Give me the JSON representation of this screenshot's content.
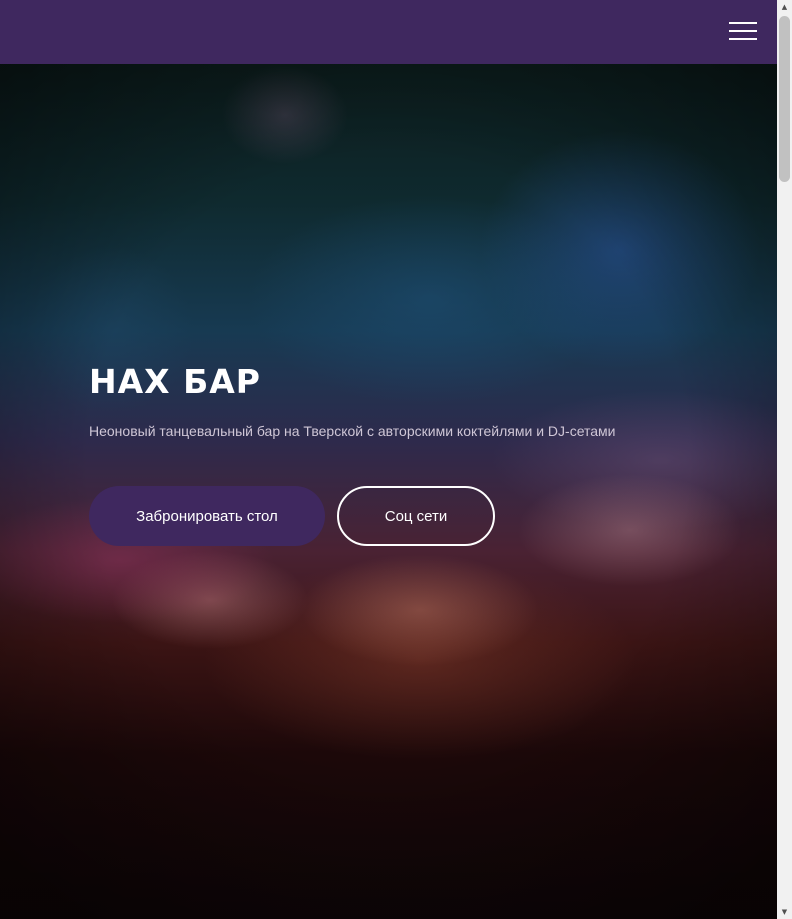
{
  "header": {
    "menu_icon": "hamburger-menu-icon",
    "background_color": "#3f285f"
  },
  "hero": {
    "title": "НАХ БАР",
    "subtitle": "Неоновый танцевальный бар на Тверской с авторскими коктейлями и DJ-сетами",
    "buttons": {
      "book_label": "Забронировать стол",
      "social_label": "Соц сети"
    }
  },
  "scrollbar": {
    "up_icon": "scroll-up-arrow-icon",
    "down_icon": "scroll-down-arrow-icon"
  },
  "colors": {
    "accent": "#3f285f",
    "text_primary": "#ffffff",
    "text_secondary": "#cfc6d6"
  }
}
